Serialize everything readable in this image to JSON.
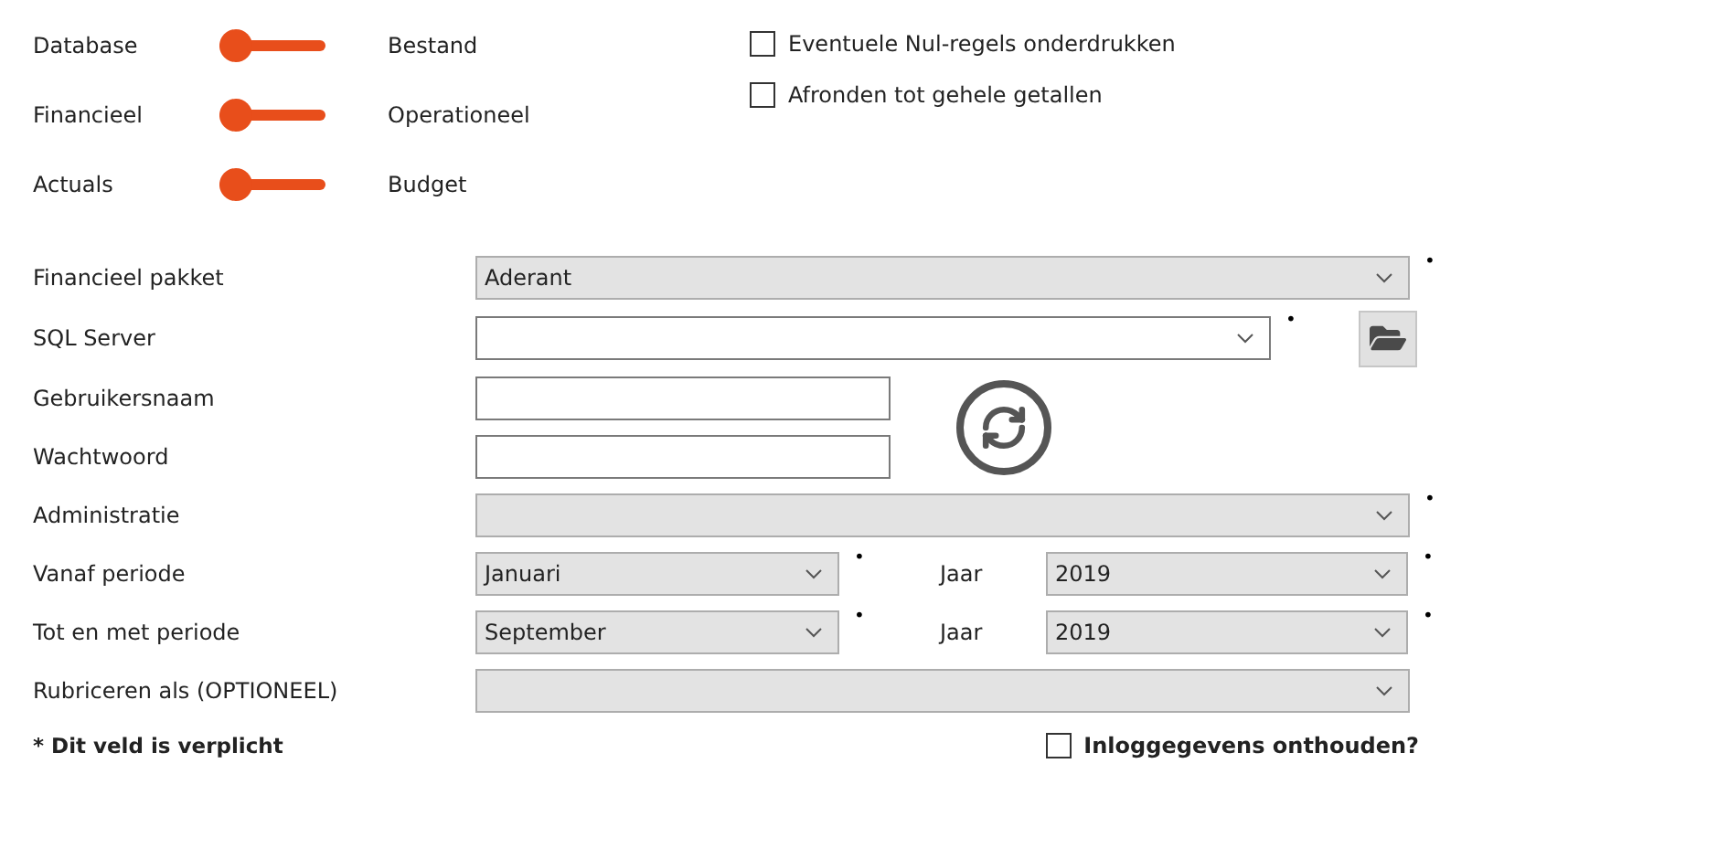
{
  "mode_toggles": [
    {
      "left_label": "Database",
      "right_label": "Bestand",
      "on": false
    },
    {
      "left_label": "Financieel",
      "right_label": "Operationeel",
      "on": false
    },
    {
      "left_label": "Actuals",
      "right_label": "Budget",
      "on": false
    }
  ],
  "options": [
    {
      "label": "Eventuele Nul-regels onderdrukken",
      "checked": false
    },
    {
      "label": "Afronden tot gehele getallen",
      "checked": false
    }
  ],
  "fields": [
    {
      "kind": "select",
      "label": "Financieel pakket",
      "value": "Aderant",
      "disabled": true,
      "required_mark": "•"
    },
    {
      "kind": "server",
      "label": "SQL Server",
      "disabled": false,
      "required_mark": "•"
    },
    {
      "kind": "credentials",
      "rows": [
        {
          "label": "Gebruikersnaam"
        },
        {
          "label": "Wachtwoord"
        }
      ]
    },
    {
      "kind": "select",
      "label": "Administratie",
      "disabled": true,
      "required_mark": "•"
    },
    {
      "kind": "period",
      "label": "Vanaf periode",
      "value": "Januari",
      "required_mark": "•",
      "year_label": "Jaar",
      "year_value": "2019",
      "year_required_mark": "•"
    },
    {
      "kind": "period",
      "label": "Tot en met periode",
      "value": "September",
      "required_mark": "•",
      "year_label": "Jaar",
      "year_value": "2019",
      "year_required_mark": "•"
    },
    {
      "kind": "select",
      "label": "Rubriceren als (OPTIONEEL)",
      "disabled": true
    }
  ],
  "footnote": "* Dit veld is verplicht",
  "remember": {
    "label": "Inloggegevens onthouden?",
    "checked": false
  }
}
